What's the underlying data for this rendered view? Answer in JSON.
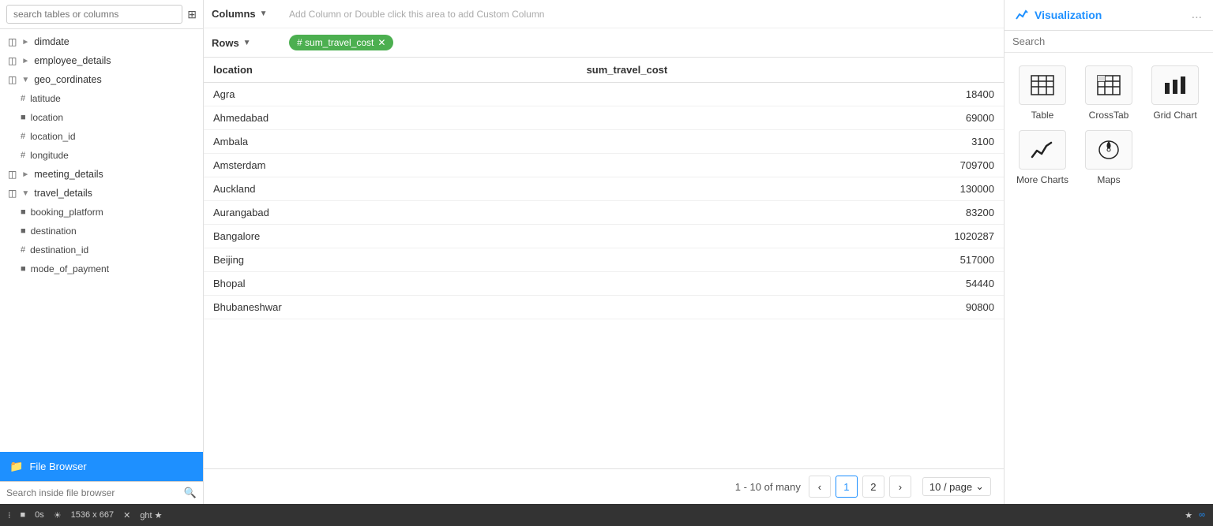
{
  "sidebar": {
    "search_placeholder": "search tables or columns",
    "tables": [
      {
        "name": "dimdate",
        "type": "table",
        "expanded": false
      },
      {
        "name": "employee_details",
        "type": "table",
        "expanded": false
      },
      {
        "name": "geo_cordinates",
        "type": "table",
        "expanded": true
      },
      {
        "name": "latitude",
        "type": "number",
        "parent": "geo_cordinates"
      },
      {
        "name": "location",
        "type": "text",
        "parent": "geo_cordinates"
      },
      {
        "name": "location_id",
        "type": "number",
        "parent": "geo_cordinates"
      },
      {
        "name": "longitude",
        "type": "number",
        "parent": "geo_cordinates"
      },
      {
        "name": "meeting_details",
        "type": "table",
        "expanded": false
      },
      {
        "name": "travel_details",
        "type": "table",
        "expanded": true
      },
      {
        "name": "booking_platform",
        "type": "text",
        "parent": "travel_details"
      },
      {
        "name": "destination",
        "type": "text",
        "parent": "travel_details"
      },
      {
        "name": "destination_id",
        "type": "number",
        "parent": "travel_details"
      },
      {
        "name": "mode_of_payment",
        "type": "text",
        "parent": "travel_details"
      }
    ],
    "file_browser_label": "File Browser",
    "file_browser_search_placeholder": "Search inside file browser"
  },
  "toolbar": {
    "columns_label": "Columns",
    "columns_hint": "Add Column or Double click this area to add Custom Column",
    "rows_label": "Rows",
    "rows_chip": "sum_travel_cost"
  },
  "table": {
    "col_location": "location",
    "col_value": "sum_travel_cost",
    "rows": [
      {
        "location": "Agra",
        "value": "18400"
      },
      {
        "location": "Ahmedabad",
        "value": "69000"
      },
      {
        "location": "Ambala",
        "value": "3100"
      },
      {
        "location": "Amsterdam",
        "value": "709700"
      },
      {
        "location": "Auckland",
        "value": "130000"
      },
      {
        "location": "Aurangabad",
        "value": "83200"
      },
      {
        "location": "Bangalore",
        "value": "1020287"
      },
      {
        "location": "Beijing",
        "value": "517000"
      },
      {
        "location": "Bhopal",
        "value": "54440"
      },
      {
        "location": "Bhubaneshwar",
        "value": "90800"
      }
    ],
    "pagination_info": "1 - 10 of many",
    "page_current": "1",
    "page_next": "2",
    "per_page": "10 / page"
  },
  "visualization": {
    "title": "Visualization",
    "search_placeholder": "Search",
    "more_icon": "...",
    "items": [
      {
        "id": "table",
        "label": "Table",
        "icon": "table"
      },
      {
        "id": "crosstab",
        "label": "CrossTab",
        "icon": "crosstab"
      },
      {
        "id": "gridchart",
        "label": "Grid Chart",
        "icon": "gridchart"
      },
      {
        "id": "morecharts",
        "label": "More Charts",
        "icon": "morecharts"
      },
      {
        "id": "maps",
        "label": "Maps",
        "icon": "maps"
      }
    ]
  },
  "statusbar": {
    "time": "0s",
    "dimensions": "1536 x 667"
  }
}
